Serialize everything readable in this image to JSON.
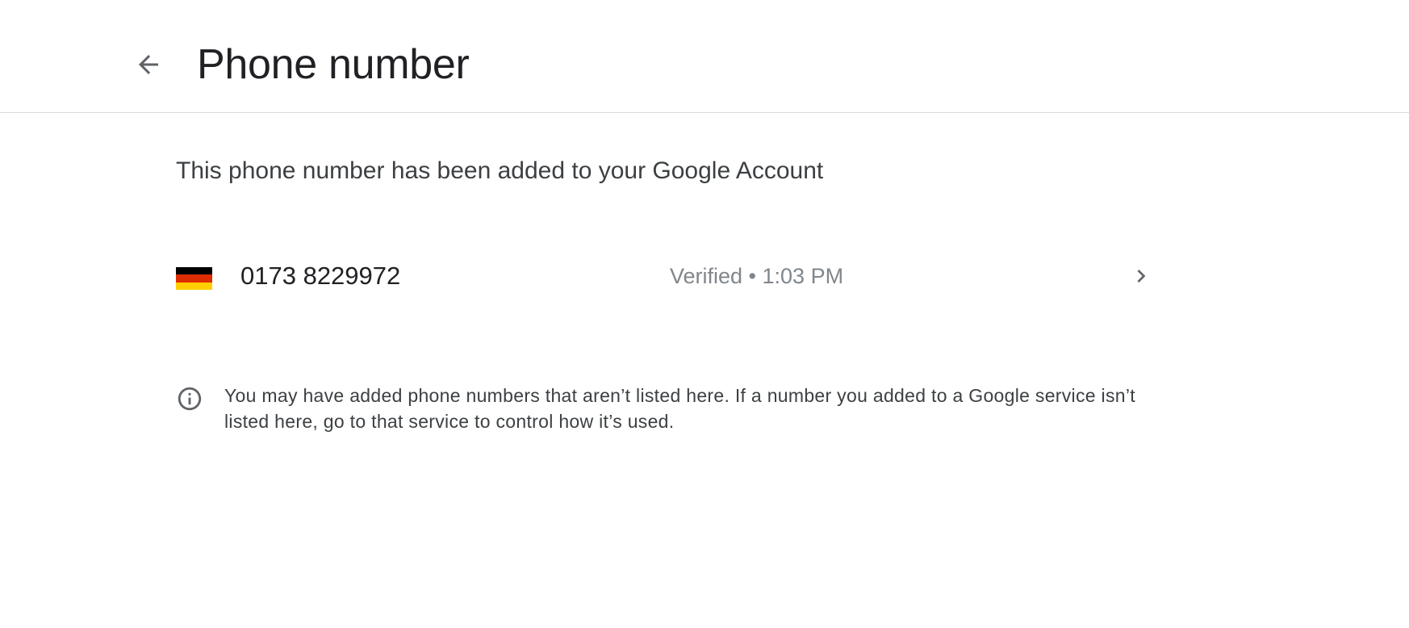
{
  "header": {
    "title": "Phone number",
    "back_icon": "arrow-back-icon"
  },
  "main": {
    "subtitle": "This phone number has been added to your Google Account",
    "phone": {
      "number": "0173 8229972",
      "status": "Verified • 1:03 PM",
      "flag_icon": "germany-flag-icon",
      "flag_colors": [
        "#000000",
        "#dd2c00",
        "#ffce00"
      ],
      "chevron_icon": "chevron-right-icon"
    },
    "info": {
      "icon": "info-icon",
      "text": "You may have added phone numbers that aren’t listed here. If a number you added to a Google service isn’t listed here, go to that service to control how it’s used."
    }
  },
  "colors": {
    "text_primary": "#202124",
    "text_secondary": "#3c4043",
    "text_muted": "#80868b",
    "icon": "#5f6368",
    "divider": "#dadce0"
  }
}
